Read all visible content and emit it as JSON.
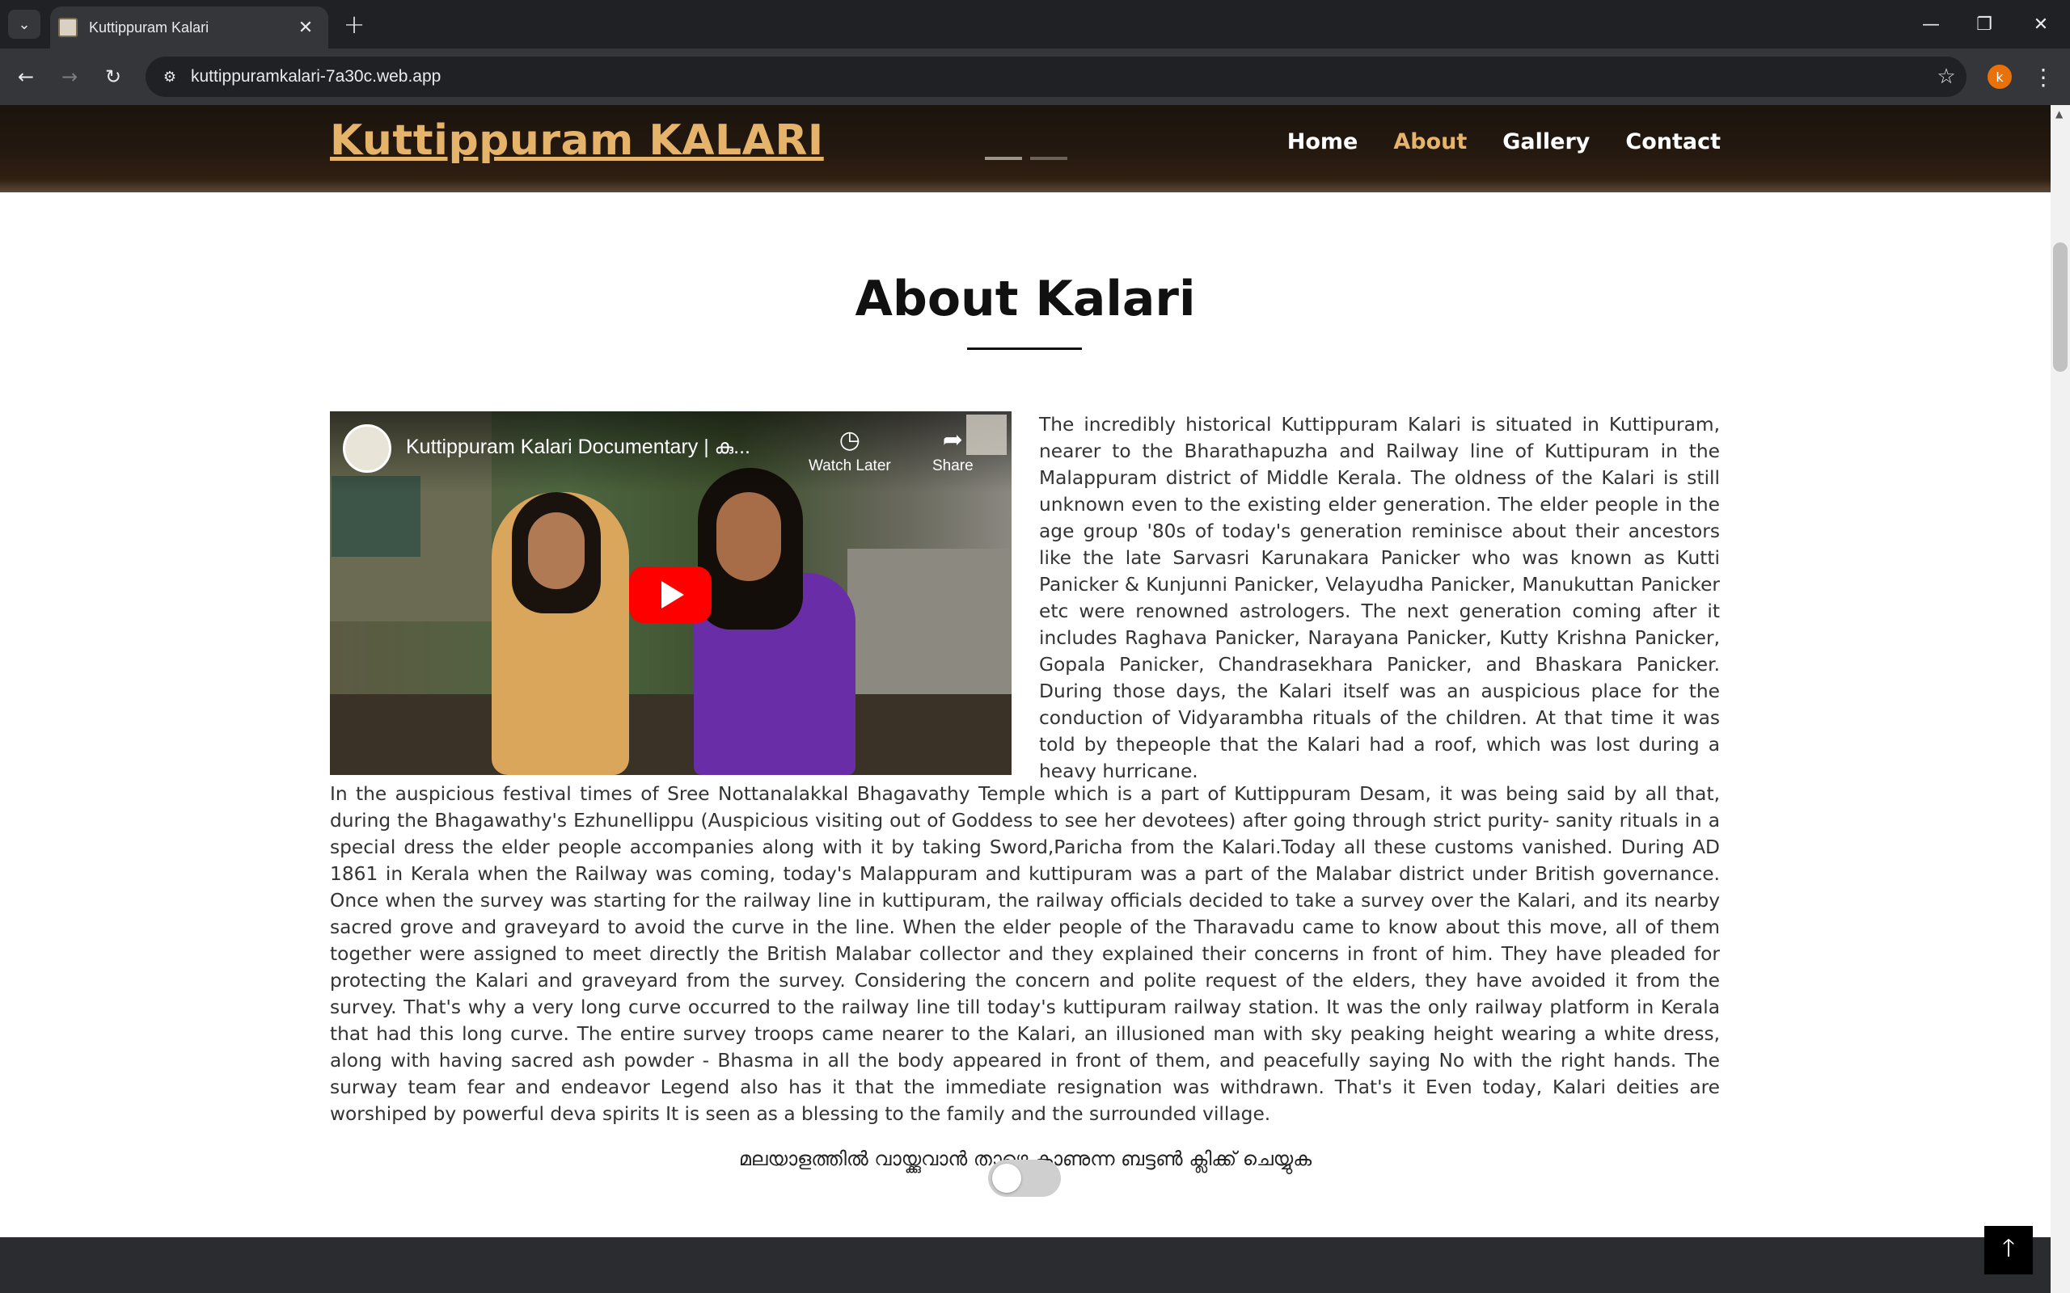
{
  "browser": {
    "tab_title": "Kuttippuram Kalari",
    "url": "kuttippuramkalari-7a30c.web.app",
    "profile_initial": "k"
  },
  "site": {
    "brand": "Kuttippuram KALARI",
    "nav": [
      {
        "label": "Home",
        "active": false
      },
      {
        "label": "About",
        "active": true
      },
      {
        "label": "Gallery",
        "active": false
      },
      {
        "label": "Contact",
        "active": false
      }
    ],
    "accent_color": "#e6b36a"
  },
  "about": {
    "title": "About Kalari",
    "video": {
      "title": "Kuttippuram Kalari Documentary | കു...",
      "watch_later": "Watch Later",
      "share": "Share"
    },
    "paragraph_side": "The incredibly historical Kuttippuram Kalari is situated in Kuttipuram, nearer to the Bharathapuzha and Railway line of Kuttipuram in the Malappuram district of Middle Kerala. The oldness of the Kalari is still unknown even to the existing elder generation. The elder people in the age group '80s of today's generation reminisce about their ancestors like the late Sarvasri Karunakara Panicker who was known as Kutti Panicker & Kunjunni Panicker, Velayudha Panicker, Manukuttan Panicker etc were renowned astrologers. The next generation coming after it includes Raghava Panicker, Narayana Panicker, Kutty Krishna Panicker, Gopala Panicker, Chandrasekhara Panicker, and Bhaskara Panicker. During those days, the Kalari itself was an auspicious place for the conduction of Vidyarambha rituals of the children. At that time it was told by thepeople that the Kalari had a roof, which was lost during a heavy hurricane.",
    "paragraph_full": "In the auspicious festival times of Sree Nottanalakkal Bhagavathy Temple which is a part of Kuttippuram Desam, it was being said by all that, during the Bhagawathy's Ezhunellippu (Auspicious visiting out of Goddess to see her devotees) after going through strict purity- sanity rituals in a special dress the elder people accompanies along with it by taking Sword,Paricha from the Kalari.Today all these customs vanished. During AD 1861 in Kerala when the Railway was coming, today's Malappuram and kuttipuram was a part of the Malabar district under British governance. Once when the survey was starting for the railway line in kuttipuram, the railway officials decided to take a survey over the Kalari, and its nearby sacred grove and graveyard to avoid the curve in the line. When the elder people of the Tharavadu came to know about this move, all of them together were assigned to meet directly the British Malabar collector and they explained their concerns in front of him. They have pleaded for protecting the Kalari and graveyard from the survey. Considering the concern and polite request of the elders, they have avoided it from the survey. That's why a very long curve occurred to the railway line till today's kuttipuram railway station. It was the only railway platform in Kerala that had this long curve. The entire survey troops came nearer to the Kalari, an illusioned man with sky peaking height wearing a white dress, along with having sacred ash powder - Bhasma in all the body appeared in front of them, and peacefully saying No with the right hands. The surway team fear and endeavor Legend also has it that the immediate resignation was withdrawn. That's it Even today, Kalari deities are worshiped by powerful deva spirits It is seen as a blessing to the family and the surrounded village.",
    "malayalam_prompt": "മലയാളത്തിൽ വായ്ക്കുവാൻ താഴെ കാണുന്ന ബട്ടൺ ക്ലിക്ക് ചെയ്യുക",
    "toggle_on": false
  }
}
